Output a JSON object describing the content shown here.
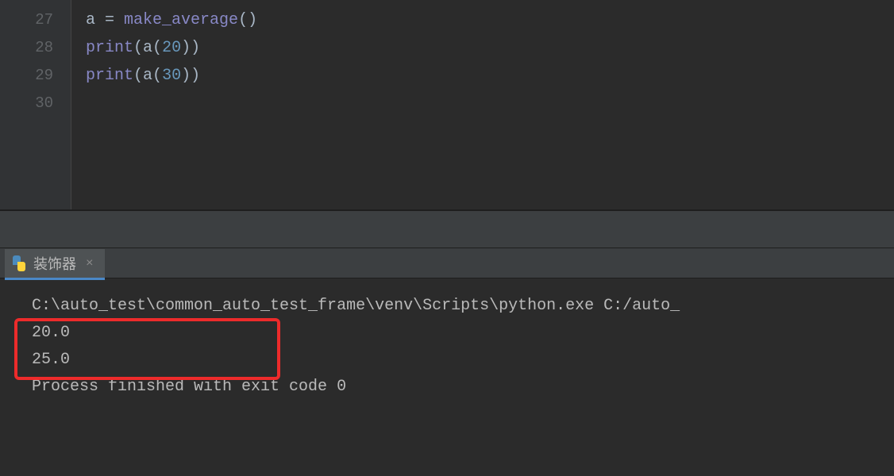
{
  "editor": {
    "lines": [
      {
        "num": "27",
        "tokens": [
          {
            "t": "a ",
            "c": "tk-default"
          },
          {
            "t": "= ",
            "c": "tk-op"
          },
          {
            "t": "make_average",
            "c": "tk-func"
          },
          {
            "t": "()",
            "c": "tk-paren"
          }
        ]
      },
      {
        "num": "28",
        "tokens": [
          {
            "t": "print",
            "c": "tk-func"
          },
          {
            "t": "(",
            "c": "tk-paren"
          },
          {
            "t": "a",
            "c": "tk-default"
          },
          {
            "t": "(",
            "c": "tk-paren"
          },
          {
            "t": "20",
            "c": "tk-number"
          },
          {
            "t": "))",
            "c": "tk-paren"
          }
        ]
      },
      {
        "num": "29",
        "tokens": [
          {
            "t": "print",
            "c": "tk-func"
          },
          {
            "t": "(",
            "c": "tk-paren"
          },
          {
            "t": "a",
            "c": "tk-default"
          },
          {
            "t": "(",
            "c": "tk-paren"
          },
          {
            "t": "30",
            "c": "tk-number"
          },
          {
            "t": "))",
            "c": "tk-paren"
          }
        ]
      },
      {
        "num": "30",
        "tokens": []
      }
    ]
  },
  "console": {
    "tab_label": "装饰器",
    "close_symbol": "×",
    "command_line": "C:\\auto_test\\common_auto_test_frame\\venv\\Scripts\\python.exe C:/auto_",
    "output1": "20.0",
    "output2": "25.0",
    "blank": "",
    "exit_msg": "Process finished with exit code 0"
  }
}
